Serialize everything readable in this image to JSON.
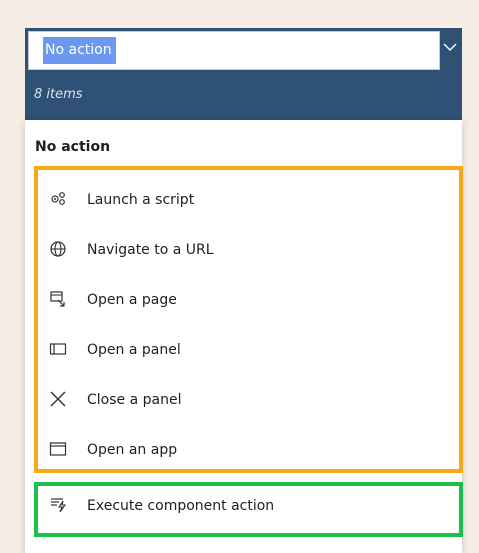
{
  "combobox": {
    "selected_value": "No action"
  },
  "list": {
    "count_text": "8 items",
    "header_item": "No action",
    "items": [
      {
        "label": "Launch a script",
        "icon": "script-gears-icon"
      },
      {
        "label": "Navigate to a URL",
        "icon": "globe-icon"
      },
      {
        "label": "Open a page",
        "icon": "open-page-icon"
      },
      {
        "label": "Open a panel",
        "icon": "panel-icon"
      },
      {
        "label": "Close a panel",
        "icon": "close-x-icon"
      },
      {
        "label": "Open an app",
        "icon": "app-window-icon"
      },
      {
        "label": "Execute component action",
        "icon": "component-action-icon"
      }
    ]
  },
  "colors": {
    "header_blue": "#2f5175",
    "selection_blue": "#6c99ef",
    "highlight_orange": "#f7aa17",
    "highlight_green": "#1bbf4a",
    "page_background": "#f6ede4"
  }
}
